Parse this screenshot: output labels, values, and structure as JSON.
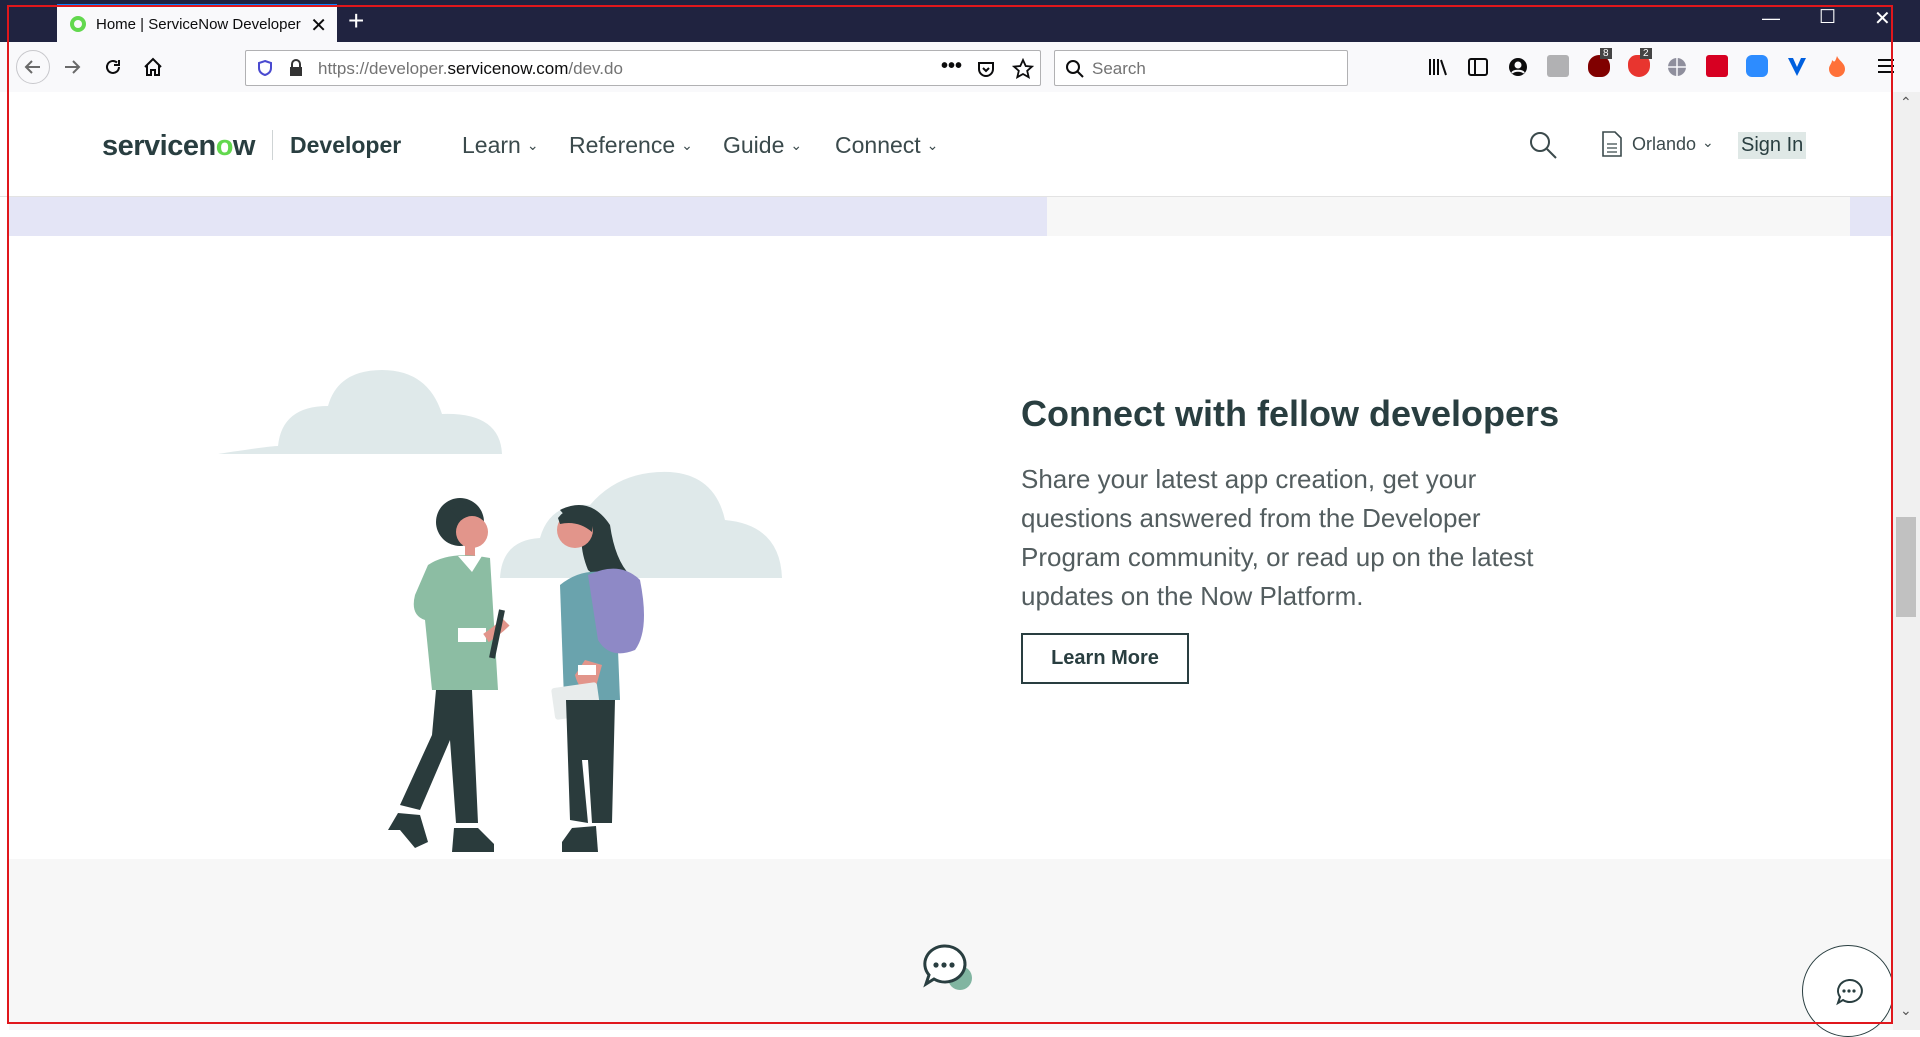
{
  "browser": {
    "tab_title": "Home | ServiceNow Developer",
    "url_prefix": "https://developer.",
    "url_domain": "servicenow.com",
    "url_path": "/dev.do",
    "search_placeholder": "Search",
    "badge_ublock": "8",
    "badge_brave": "2",
    "icons": [
      "back-icon",
      "forward-icon",
      "reload-icon",
      "home-icon",
      "shield-icon",
      "lock-icon",
      "more-icon",
      "pocket-icon",
      "star-icon",
      "library-icon",
      "sidebar-icon",
      "account-icon",
      "ublock-icon",
      "brave-icon",
      "globe-icon",
      "zoom-icon",
      "menu-icon"
    ]
  },
  "header": {
    "logo_pre": "servicen",
    "logo_o": "o",
    "logo_post": "w",
    "section": "Developer",
    "menu": [
      {
        "label": "Learn"
      },
      {
        "label": "Reference"
      },
      {
        "label": "Guide"
      },
      {
        "label": "Connect"
      }
    ],
    "release": "Orlando",
    "signin": "Sign In"
  },
  "main": {
    "title": "Connect with fellow developers",
    "body": "Share your latest app creation, get your questions answered from the Developer Program community, or read up on the latest updates on the Now Platform.",
    "cta": "Learn More"
  },
  "colors": {
    "brand_green": "#62d84e",
    "text_dark": "#293e40",
    "band_lavender": "#e4e5f6",
    "tab_accent": "#0a84ff",
    "frame_red": "#e0171c"
  }
}
